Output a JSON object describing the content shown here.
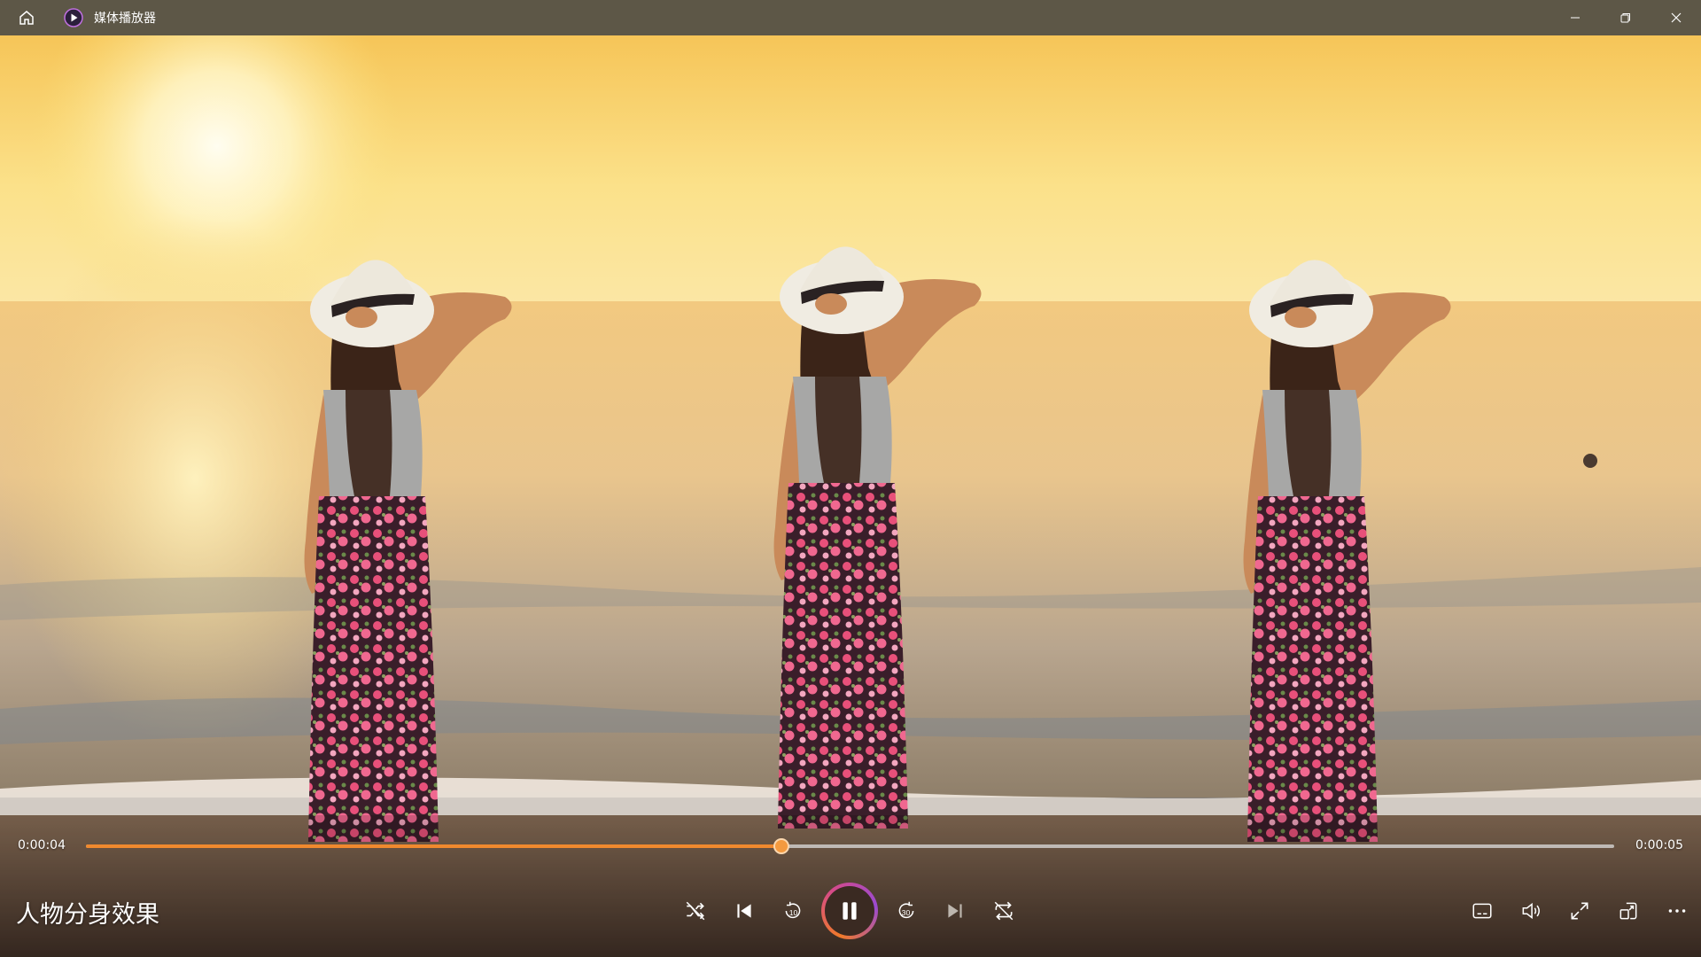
{
  "titlebar": {
    "app_title": "媒体播放器",
    "icons": {
      "home": "home-icon",
      "logo": "media-player-logo-icon",
      "minimize": "minimize-icon",
      "restore": "restore-icon",
      "close": "close-icon"
    }
  },
  "player": {
    "current_time": "0:00:04",
    "total_time": "0:00:05",
    "progress": 0.455,
    "media_title": "人物分身效果",
    "accent_color": "#f0892e",
    "state": "playing"
  },
  "controls": {
    "center": [
      "shuffle-icon",
      "previous-icon",
      "rewind-10-icon",
      "pause-icon",
      "forward-30-icon",
      "next-icon",
      "repeat-off-icon"
    ],
    "right": [
      "subtitles-icon",
      "volume-icon",
      "fullscreen-icon",
      "mini-player-icon",
      "more-icon"
    ],
    "rewind_label": "10",
    "forward_label": "30"
  }
}
